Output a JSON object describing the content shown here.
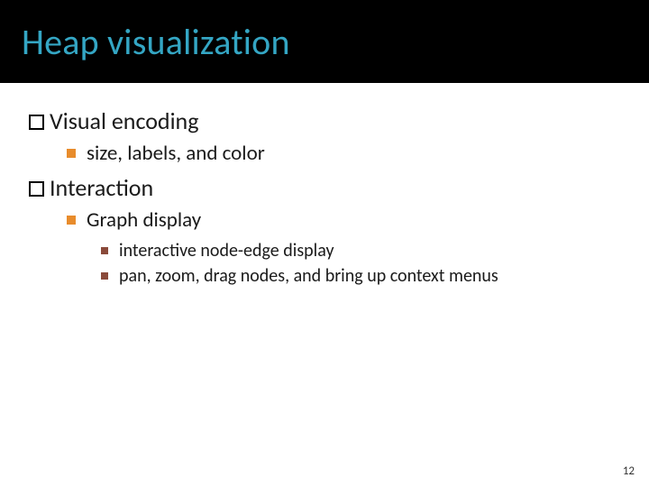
{
  "title": "Heap visualization",
  "l1": {
    "visual_encoding": "Visual encoding",
    "interaction": "Interaction"
  },
  "l2": {
    "size_labels_color": "size, labels, and color",
    "graph_display": "Graph display"
  },
  "l3": {
    "node_edge": "interactive node-edge display",
    "pan_zoom": "pan, zoom, drag nodes, and bring up context menus"
  },
  "page_number": "12"
}
